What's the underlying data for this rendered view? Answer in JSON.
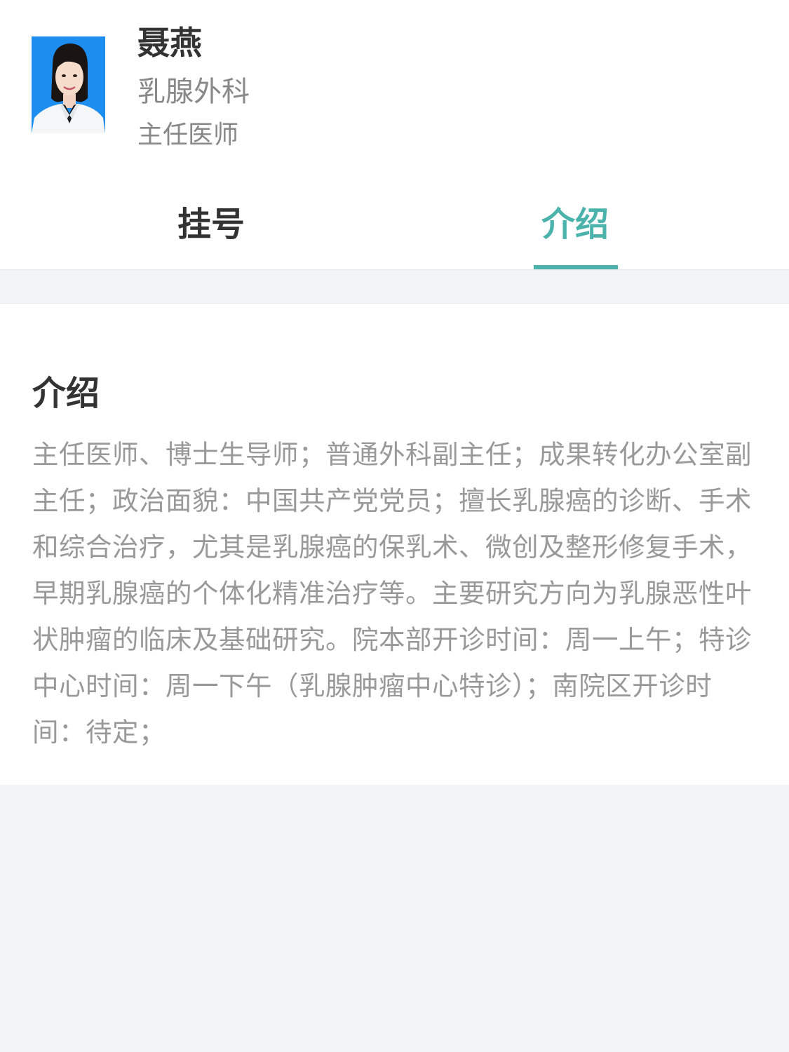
{
  "doctor": {
    "name": "聂燕",
    "department": "乳腺外科",
    "title": "主任医师"
  },
  "tabs": [
    {
      "label": "挂号",
      "active": false
    },
    {
      "label": "介绍",
      "active": true
    }
  ],
  "intro": {
    "heading": "介绍",
    "body": "主任医师、博士生导师；普通外科副主任；成果转化办公室副主任；政治面貌：中国共产党党员；擅长乳腺癌的诊断、手术和综合治疗，尤其是乳腺癌的保乳术、微创及整形修复手术，早期乳腺癌的个体化精准治疗等。主要研究方向为乳腺恶性叶状肿瘤的临床及基础研究。院本部开诊时间：周一上午；特诊中心时间：周一下午（乳腺肿瘤中心特诊）；南院区开诊时间：待定；"
  },
  "colors": {
    "accent": "#4cb3ac",
    "text_primary": "#333333",
    "text_secondary": "#888888",
    "text_body": "#999999",
    "page_background": "#f1f5f5",
    "photo_background": "#1d8ef0"
  }
}
